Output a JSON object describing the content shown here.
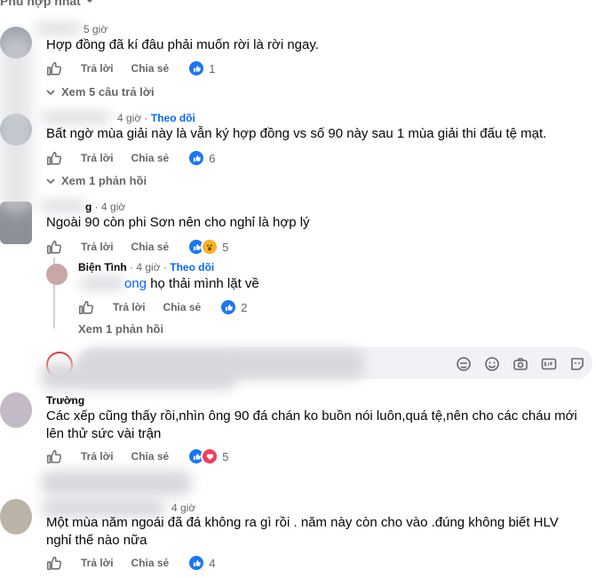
{
  "sort": {
    "label": "Phù hợp nhất"
  },
  "actions": {
    "reply": "Trả lời",
    "share": "Chia sẻ"
  },
  "comments": [
    {
      "time": "5 giờ",
      "text": "Hợp đồng đã kí đâu phải muốn rời là rời ngay.",
      "reaction_count": "1",
      "view_replies": "Xem 5 câu trả lời"
    },
    {
      "time": "4 giờ",
      "follow": "Theo dõi",
      "text": "Bất ngờ mùa giải này là vẫn ký hợp đồng vs số 90 này sau 1 mùa giải thi đấu tệ mạt.",
      "reaction_count": "6",
      "view_replies": "Xem 1 phản hồi"
    },
    {
      "time": "4 giờ",
      "author_fragment": "g",
      "text": "Ngoài 90 còn phi Sơn nên cho nghỉ là hợp lý",
      "reaction_count": "5"
    },
    {
      "author": "Trường",
      "text_lines": [
        "Các xếp cũng thấy rồi,nhìn ông 90 đá chán ko buồn nói luôn,quá tệ,nên cho các cháu mới",
        "lên thử sức vài trận"
      ],
      "reaction_count": "5"
    },
    {
      "time": "4 giờ",
      "text_lines": [
        "Một mùa năm ngoái đã đá không ra gì rồi . năm này còn cho vào .đúng không biết HLV",
        "nghỉ thế nào nữa"
      ],
      "reaction_count": "4"
    }
  ],
  "reply": {
    "author": "Biện Tình",
    "time": "4 giờ",
    "follow": "Theo dõi",
    "mention": "ong",
    "text": "họ thải mình lặt về",
    "reaction_count": "2",
    "view_replies": "Xem 1 phản hồi"
  },
  "colors": {
    "link": "#0866ff",
    "like": "#1877f2",
    "love": "#f33e58",
    "wow": "#f7b125",
    "muted": "#65676b"
  }
}
